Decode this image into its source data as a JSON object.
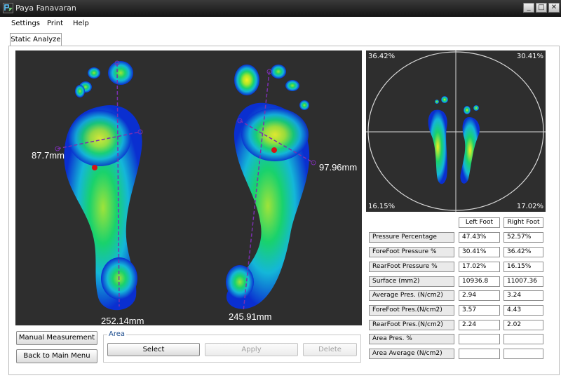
{
  "window": {
    "title": "Paya Fanavaran",
    "controls": [
      "_",
      "□",
      "✕"
    ]
  },
  "menu": {
    "items": [
      "Settings",
      "Print",
      "Help"
    ]
  },
  "tabs": {
    "active": "Static Analyze"
  },
  "viewer": {
    "left_width": "87.7mm",
    "right_width": "97.96mm",
    "left_length": "252.14mm",
    "right_length": "245.91mm"
  },
  "quadrants": {
    "top_left": "36.42%",
    "top_right": "30.41%",
    "bottom_left": "16.15%",
    "bottom_right": "17.02%"
  },
  "buttons": {
    "manual_measurement": "Manual Measurement",
    "back_to_main_menu": "Back to Main Menu"
  },
  "area": {
    "label": "Area",
    "select": "Select",
    "apply": "Apply",
    "delete": "Delete"
  },
  "table": {
    "headers": {
      "left": "Left Foot",
      "right": "Right Foot"
    },
    "rows": [
      {
        "label": "Pressure Percentage",
        "left": "47.43%",
        "right": "52.57%"
      },
      {
        "label": "ForeFoot Pressure %",
        "left": "30.41%",
        "right": "36.42%"
      },
      {
        "label": "RearFoot Pressure %",
        "left": "17.02%",
        "right": "16.15%"
      },
      {
        "label": "Surface (mm2)",
        "left": "10936.8",
        "right": "11007.36"
      },
      {
        "label": "Average Pres. (N/cm2)",
        "left": "2.94",
        "right": "3.24"
      },
      {
        "label": "ForeFoot Pres.(N/cm2)",
        "left": "3.57",
        "right": "4.43"
      },
      {
        "label": "RearFoot Pres.(N/cm2)",
        "left": "2.24",
        "right": "2.02"
      },
      {
        "label": "Area Pres. %",
        "left": "",
        "right": ""
      },
      {
        "label": "Area Average  (N/cm2)",
        "left": "",
        "right": ""
      }
    ]
  },
  "colors": {
    "titlebar": "#1e1e1e",
    "viewer_bg": "#2e2e2e",
    "heat_low": "#0a2fd0",
    "heat_mid": "#19d26c",
    "heat_high": "#f6ef1e",
    "center_dot": "#d41515",
    "measure_line": "#7b2fb0"
  }
}
